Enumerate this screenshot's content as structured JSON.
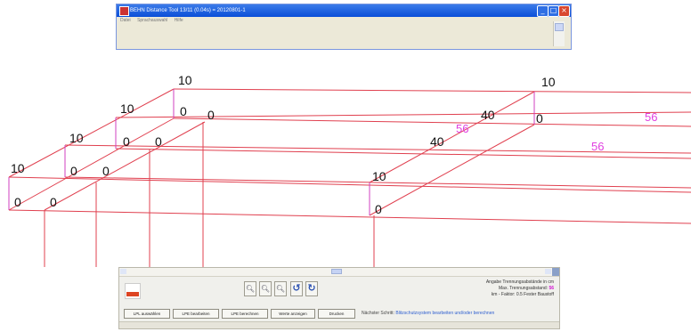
{
  "window": {
    "title": "BEHN Distance Tool 13/11 (0.04s) = 20120801-1",
    "menu": [
      "Datei",
      "Sprachauswahl",
      "Hilfe"
    ]
  },
  "drawing": {
    "labels": {
      "l1": "10",
      "l2": "10",
      "l3": "10",
      "l4": "10",
      "l5": "10",
      "l6": "10",
      "l7": "10",
      "l8": "0",
      "l9": "0",
      "l10": "0",
      "l11": "0",
      "l12": "0",
      "l13": "0",
      "l14": "0",
      "l15": "0",
      "l16": "0",
      "l17": "0",
      "l18": "40",
      "l19": "40",
      "l20": "56",
      "l21": "56",
      "l22": "56"
    }
  },
  "panel": {
    "info_line1": "Angabe Trennungsabstände in cm",
    "info_line2_label": "Max. Trennungsabstand:",
    "info_line2_value": "56",
    "info_line3": "km - Faktor: 0.5  Fester Baustoff",
    "buttons": [
      "LPL auswählen",
      "LPE bearbeiten",
      "LPE berechnen",
      "Werte anzeigen",
      "Drucken"
    ],
    "next_step_label": "Nächster Schritt:",
    "next_step_link": "Blitzschutzsystem bearbeiten und/oder berechnen"
  },
  "colors": {
    "lines": "#e0404f",
    "uprights": "#d040c0",
    "highlight_text": "#e040e0",
    "titlebar": "#0a4ed8"
  }
}
